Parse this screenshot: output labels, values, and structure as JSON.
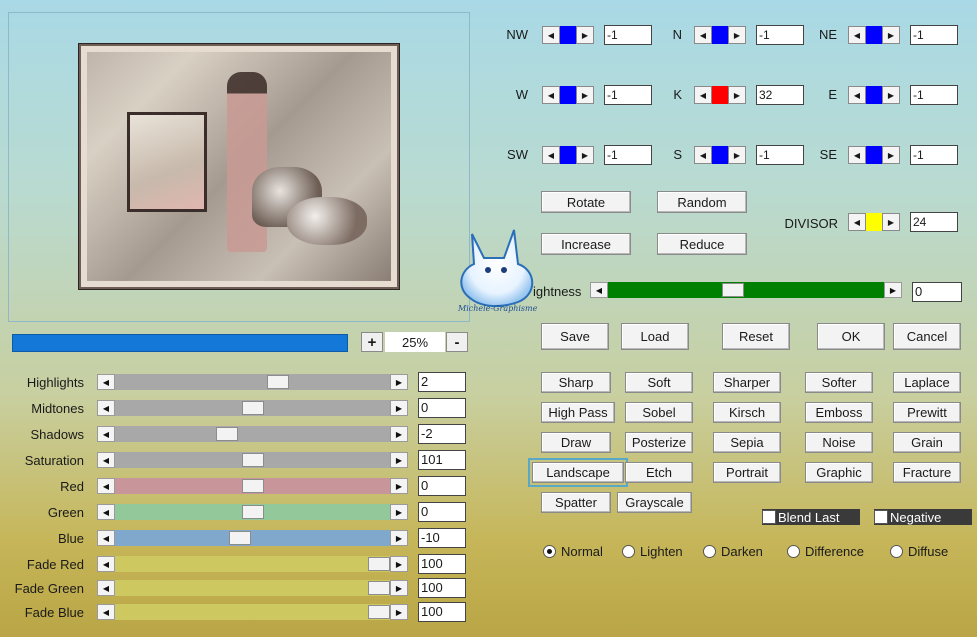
{
  "zoom": {
    "value": "25%",
    "plus": "+",
    "minus": "-"
  },
  "sliders": [
    {
      "label": "Highlights",
      "value": "2",
      "level": 0.6,
      "color": "#a8a8a8"
    },
    {
      "label": "Midtones",
      "value": "0",
      "level": 0.5,
      "color": "#a8a8a8"
    },
    {
      "label": "Shadows",
      "value": "-2",
      "level": 0.4,
      "color": "#a8a8a8"
    },
    {
      "label": "Saturation",
      "value": "101",
      "level": 0.5,
      "color": "#a8a8a8"
    },
    {
      "label": "Red",
      "value": "0",
      "level": 0.5,
      "color": "#c8959a"
    },
    {
      "label": "Green",
      "value": "0",
      "level": 0.5,
      "color": "#93c89a"
    },
    {
      "label": "Blue",
      "value": "-10",
      "level": 0.45,
      "color": "#7fa8cc"
    },
    {
      "label": "Fade Red",
      "value": "100",
      "level": 1.0,
      "color": "#cdc860"
    },
    {
      "label": "Fade Green",
      "value": "100",
      "level": 1.0,
      "color": "#cdc860"
    },
    {
      "label": "Fade Blue",
      "value": "100",
      "level": 1.0,
      "color": "#cdc860"
    }
  ],
  "kernel": [
    {
      "label": "NW",
      "value": "-1",
      "color": "#0000ff"
    },
    {
      "label": "N",
      "value": "-1",
      "color": "#0000ff"
    },
    {
      "label": "NE",
      "value": "-1",
      "color": "#0000ff"
    },
    {
      "label": "W",
      "value": "-1",
      "color": "#0000ff"
    },
    {
      "label": "K",
      "value": "32",
      "color": "#ff0000"
    },
    {
      "label": "E",
      "value": "-1",
      "color": "#0000ff"
    },
    {
      "label": "SW",
      "value": "-1",
      "color": "#0000ff"
    },
    {
      "label": "S",
      "value": "-1",
      "color": "#0000ff"
    },
    {
      "label": "SE",
      "value": "-1",
      "color": "#0000ff"
    }
  ],
  "divisor": {
    "label": "DIVISOR",
    "value": "24",
    "color": "#ffff00"
  },
  "actions": {
    "rotate": "Rotate",
    "random": "Random",
    "increase": "Increase",
    "reduce": "Reduce"
  },
  "brightness": {
    "label": "ightness",
    "value": "0",
    "level": 0.45,
    "color": "#008000"
  },
  "file_buttons": {
    "save": "Save",
    "load": "Load",
    "reset": "Reset",
    "ok": "OK",
    "cancel": "Cancel"
  },
  "presets": [
    [
      "Sharp",
      "Soft",
      "Sharper",
      "Softer",
      "Laplace"
    ],
    [
      "High Pass",
      "Sobel",
      "Kirsch",
      "Emboss",
      "Prewitt"
    ],
    [
      "Draw",
      "Posterize",
      "Sepia",
      "Noise",
      "Grain"
    ],
    [
      "Landscape",
      "Etch",
      "Portrait",
      "Graphic",
      "Fracture"
    ],
    [
      "Spatter",
      "Grayscale"
    ]
  ],
  "checks": {
    "blend_last": "Blend Last",
    "negative": "Negative"
  },
  "modes": [
    {
      "label": "Normal",
      "selected": true
    },
    {
      "label": "Lighten",
      "selected": false
    },
    {
      "label": "Darken",
      "selected": false
    },
    {
      "label": "Difference",
      "selected": false
    },
    {
      "label": "Diffuse",
      "selected": false
    }
  ],
  "watermark": {
    "text": "Michele-Graphisme"
  }
}
